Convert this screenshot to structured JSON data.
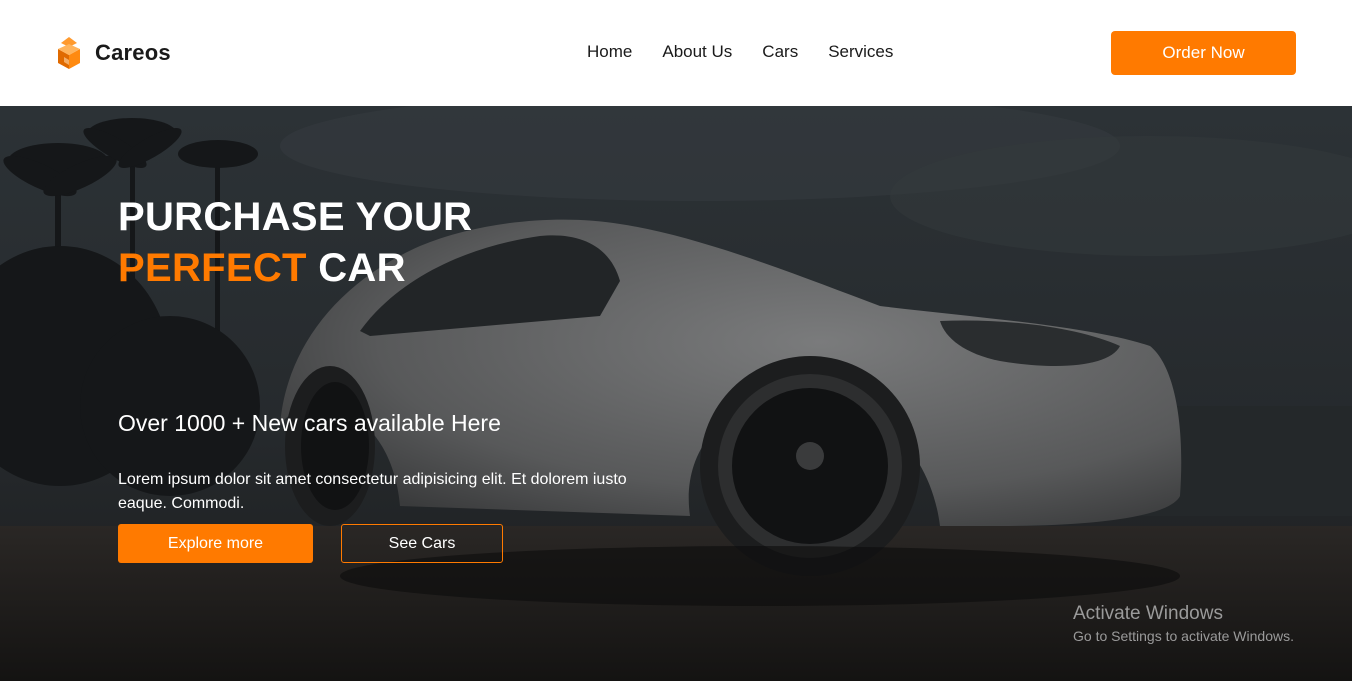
{
  "brand": {
    "name": "Careos",
    "logo_icon": "cube-logo-icon",
    "accent_color": "#ff7a00"
  },
  "nav": {
    "items": [
      {
        "label": "Home"
      },
      {
        "label": "About Us"
      },
      {
        "label": "Cars"
      },
      {
        "label": "Services"
      }
    ]
  },
  "header": {
    "cta_label": "Order Now"
  },
  "hero": {
    "headline_line1": "PURCHASE YOUR",
    "headline_accent": "PERFECT",
    "headline_rest": "CAR",
    "subheading": "Over 1000 + New cars available Here",
    "description": "Lorem ipsum dolor sit amet consectetur adipisicing elit. Et dolorem iusto eaque. Commodi.",
    "primary_button": "Explore more",
    "secondary_button": "See Cars",
    "background_image": "white-sports-car-photo"
  },
  "watermark": {
    "title": "Activate Windows",
    "subtitle": "Go to Settings to activate Windows."
  }
}
